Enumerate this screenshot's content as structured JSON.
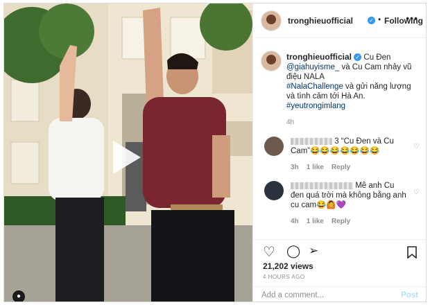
{
  "post": {
    "username": "tronghieuofficial",
    "follow_status": "Following",
    "caption_user": "tronghieuofficial",
    "caption_line1": "Cu Đen",
    "mention": "@giahuyisme_",
    "caption_line2": " và Cu Cam nhảy vũ điệu NALA",
    "hashtag1": "#NalaChallenge",
    "caption_line3": " và gửi năng lượng và tình cảm tới Hà An.",
    "hashtag2": "#yeutrongimlang",
    "caption_time": "4h"
  },
  "comments": [
    {
      "text_a": "3 “Cu Đen và Cu",
      "text_b": "Cam”😂😂😂😂😂😂😂",
      "time": "3h",
      "likes": "1 like",
      "reply": "Reply"
    },
    {
      "text_a": "Mê anh Cu",
      "text_b": "đen quá trời mà không bằng anh cu cam😂🙆💜",
      "time": "4h",
      "likes": "1 like",
      "reply": "Reply"
    }
  ],
  "stats": {
    "views": "21,202 views",
    "posted": "4 HOURS AGO"
  },
  "composer": {
    "placeholder": "Add a comment...",
    "post_label": "Post"
  },
  "icons": [
    "verified-icon",
    "more-icon",
    "play-icon",
    "heart-icon",
    "comment-icon",
    "share-icon",
    "bookmark-icon",
    "user-tag-icon"
  ],
  "colors": {
    "accent": "#3897f0",
    "text": "#262626",
    "muted": "#8e8e8e",
    "post_disabled": "#b2dffc"
  }
}
